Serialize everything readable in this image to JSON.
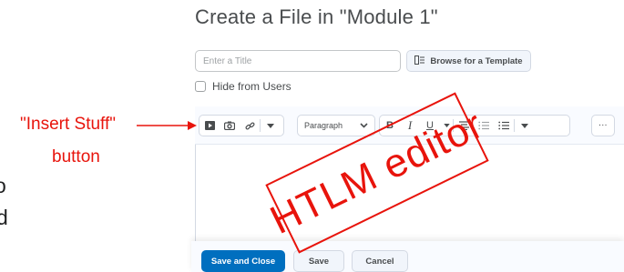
{
  "page": {
    "title": "Create a File in \"Module 1\""
  },
  "form": {
    "title_placeholder": "Enter a Title",
    "title_value": "",
    "browse_template_label": "Browse for a Template",
    "hide_label": "Hide from Users",
    "hide_checked": false
  },
  "toolbar": {
    "insert_stuff_icon": "play-square-icon",
    "insert_image_icon": "camera-icon",
    "insert_link_icon": "link-icon",
    "block_format": "Paragraph",
    "bold_label": "B",
    "italic_label": "I",
    "underline_label": "U",
    "more_label": "..."
  },
  "footer": {
    "save_close_label": "Save and Close",
    "save_label": "Save",
    "cancel_label": "Cancel"
  },
  "annotations": {
    "insert_stuff_label_line1": "\"Insert Stuff\"",
    "insert_stuff_label_line2": "button",
    "stamp_text": "HTLM editor",
    "left_fragment_1": "o",
    "left_fragment_2": "d"
  },
  "colors": {
    "annotation_red": "#e8140c",
    "primary_blue": "#006fbf"
  }
}
